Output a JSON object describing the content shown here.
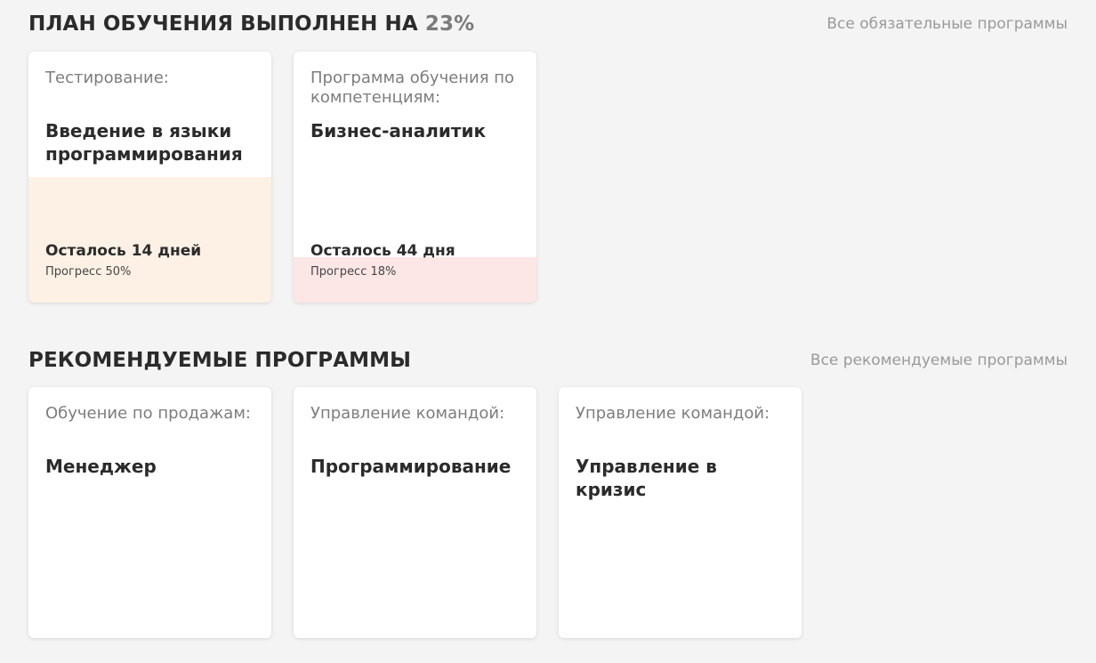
{
  "mandatory": {
    "title_prefix": "ПЛАН ОБУЧЕНИЯ ВЫПОЛНЕН НА",
    "title_percent": "23%",
    "link": "Все обязательные программы",
    "cards": [
      {
        "category": "Тестирование:",
        "title": "Введение в языки программирования",
        "remaining": "Осталось 14 дней",
        "progress_label": "Прогресс 50%",
        "progress": 50,
        "fill_color": "#fdf1e5"
      },
      {
        "category": "Программа обучения по компетенциям:",
        "title": "Бизнес-аналитик",
        "remaining": "Осталось 44 дня",
        "progress_label": "Прогресс 18%",
        "progress": 18,
        "fill_color": "#fde6e6"
      }
    ]
  },
  "recommended": {
    "title": "РЕКОМЕНДУЕМЫЕ ПРОГРАММЫ",
    "link": "Все рекомендуемые программы",
    "cards": [
      {
        "category": "Обучение по продажам:",
        "title": "Менеджер"
      },
      {
        "category": "Управление командой:",
        "title": "Программирование"
      },
      {
        "category": "Управление командой:",
        "title": "Управление в кризис"
      }
    ]
  }
}
